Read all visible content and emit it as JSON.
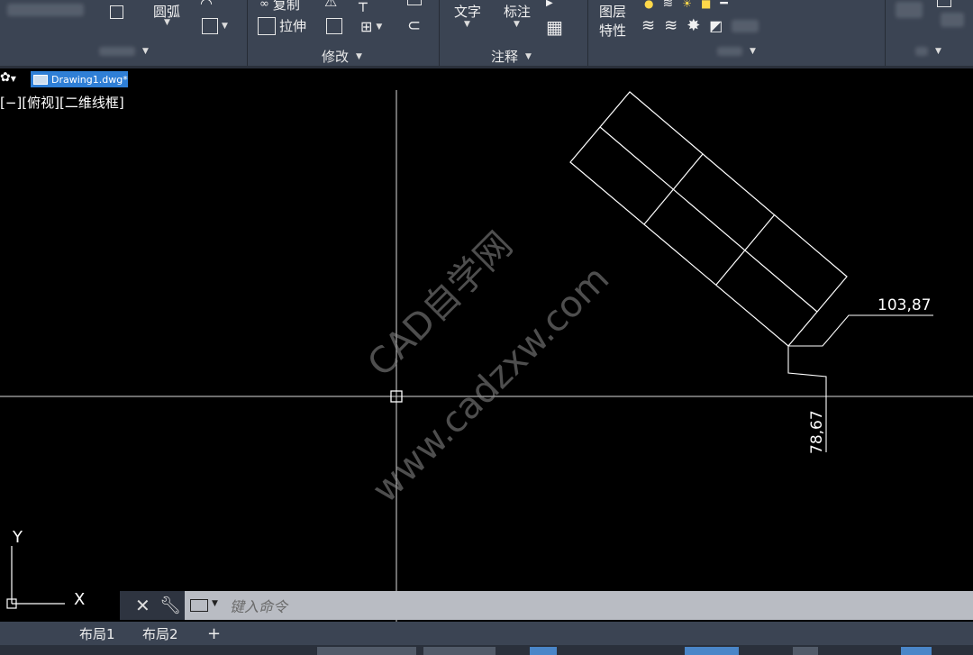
{
  "ribbon": {
    "circle_label": "圆弧",
    "copy_label": "复制",
    "stretch_label": "拉伸",
    "modify_panel": "修改",
    "text_label": "文字",
    "dimension_label": "标注",
    "annotation_panel": "注释",
    "layer_properties_line1": "图层",
    "layer_properties_line2": "特性"
  },
  "doc_tab": {
    "name": "Drawing1.dwg*"
  },
  "viewport": {
    "label": "[−][俯视][二维线框]"
  },
  "drawing": {
    "dim_horizontal": "103,87",
    "dim_vertical": "78,67",
    "ucs_y": "Y",
    "ucs_x": "X"
  },
  "watermark": {
    "line1": "CAD自学网",
    "line2": "www.cadzxw.com"
  },
  "command_line": {
    "placeholder": "键入命令"
  },
  "layouts": {
    "tabs": [
      "布局1",
      "布局2"
    ],
    "add": "+"
  },
  "colors": {
    "ribbon_bg": "#3b4453",
    "canvas_bg": "#000000",
    "tab_active": "#2f7fd6"
  }
}
